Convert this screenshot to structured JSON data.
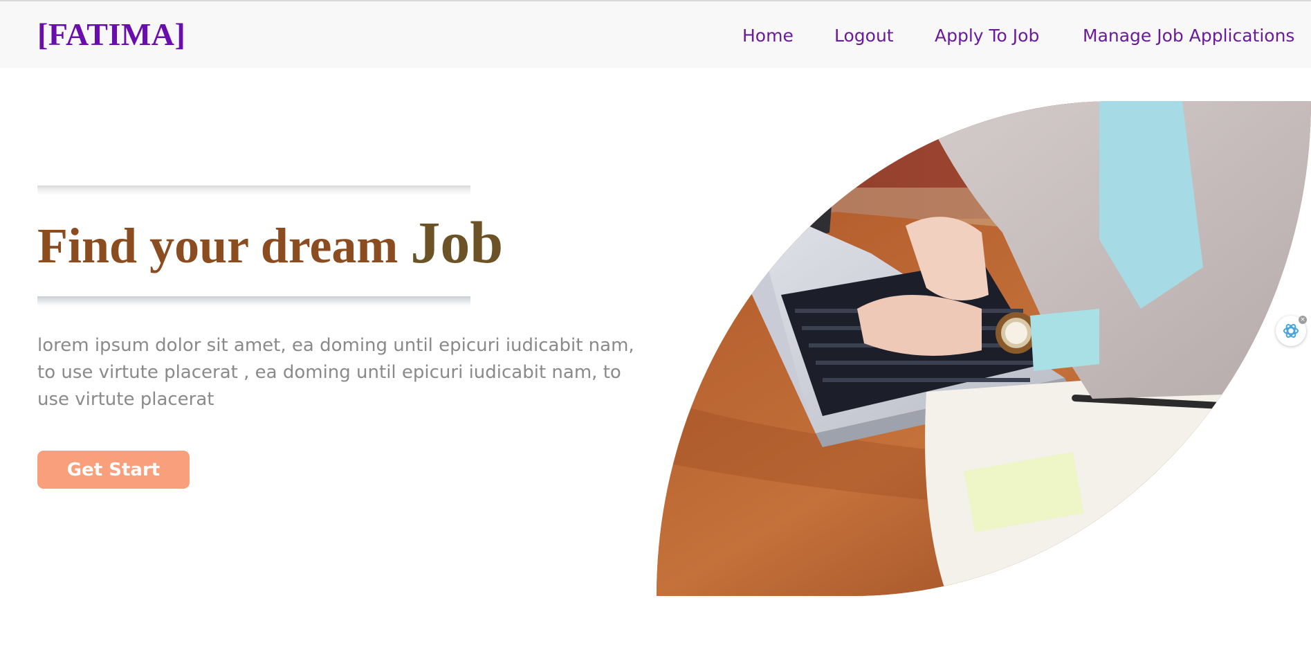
{
  "brand": {
    "name": "[FATIMA]"
  },
  "nav": {
    "items": [
      {
        "label": "Home"
      },
      {
        "label": "Logout"
      },
      {
        "label": "Apply To Job"
      },
      {
        "label": "Manage Job Applications"
      }
    ]
  },
  "hero": {
    "title_part1": "Find your dream ",
    "title_part2": "Job",
    "description": "lorem ipsum dolor sit amet, ea doming until epicuri iudicabit nam, to use virtute placerat , ea doming until epicuri iudicabit nam, to use virtute placerat",
    "cta_label": "Get Start",
    "image_icon": "person-typing-on-laptop-photo"
  },
  "widgets": {
    "assistant_icon": "assistant-swirl-icon",
    "close_glyph": "×"
  },
  "colors": {
    "brand": "#6a0dad",
    "nav_link": "#6a1b9a",
    "title_part1": "#8b4c1f",
    "title_part2": "#6b5327",
    "cta_bg": "#f99f7b",
    "body_text": "#8a8a8a",
    "nav_bg": "#f8f8f8"
  }
}
